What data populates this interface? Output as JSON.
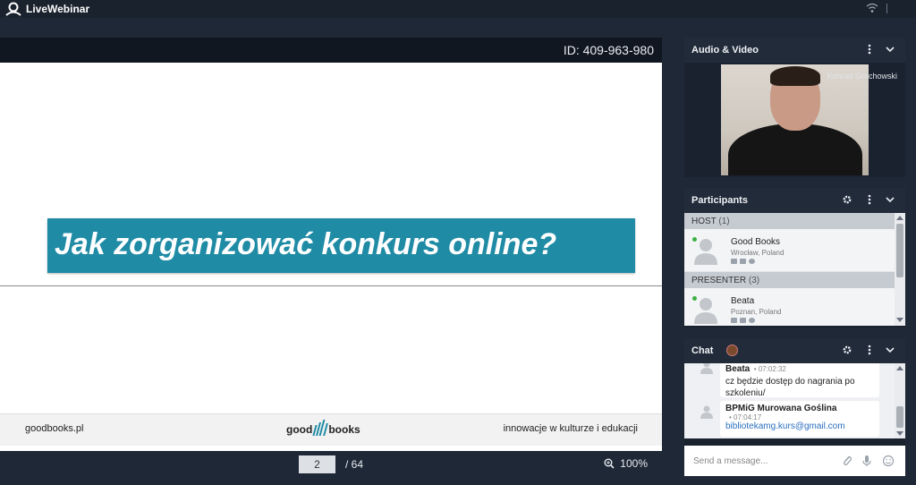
{
  "app": {
    "name": "LiveWebinar"
  },
  "presentation": {
    "webinar_id": "ID: 409-963-980",
    "slide_title": "Jak zorganizować konkurs online?",
    "footer_left": "goodbooks.pl",
    "footer_logo_left": "good",
    "footer_logo_right": "books",
    "footer_right": "innowacje w kulturze i edukacji",
    "current_page": "2",
    "total_pages": "/ 64",
    "zoom": "100%"
  },
  "audio_video": {
    "title": "Audio & Video",
    "presenter_name": "Konrad Grochowski"
  },
  "participants": {
    "title": "Participants",
    "groups": [
      {
        "label": "HOST",
        "count": "(1)",
        "people": [
          {
            "name": "Good Books",
            "location": "Wrocław, Poland"
          }
        ]
      },
      {
        "label": "PRESENTER",
        "count": "(3)",
        "people": [
          {
            "name": "Beata",
            "location": "Poznan, Poland"
          }
        ]
      }
    ]
  },
  "chat": {
    "title": "Chat",
    "messages": [
      {
        "author": "Beata",
        "time": "• 07:02:32",
        "text": "cz będzie dostęp do nagrania po szkoleniu/"
      },
      {
        "author": "BPMiG Murowana Goślina",
        "time": "• 07:04:17",
        "text": "bibliotekamg.kurs@gmail.com"
      }
    ],
    "input_placeholder": "Send a message..."
  },
  "colors": {
    "accent": "#1f8ba5",
    "background": "#1f2836",
    "online": "#3cb043"
  },
  "icons": [
    "livewebinar-logo-icon",
    "wifi-icon",
    "zoom-icon",
    "more-vertical-icon",
    "chevron-down-icon",
    "gear-icon",
    "user-avatar-icon",
    "attachment-icon",
    "microphone-icon",
    "emoji-icon"
  ]
}
